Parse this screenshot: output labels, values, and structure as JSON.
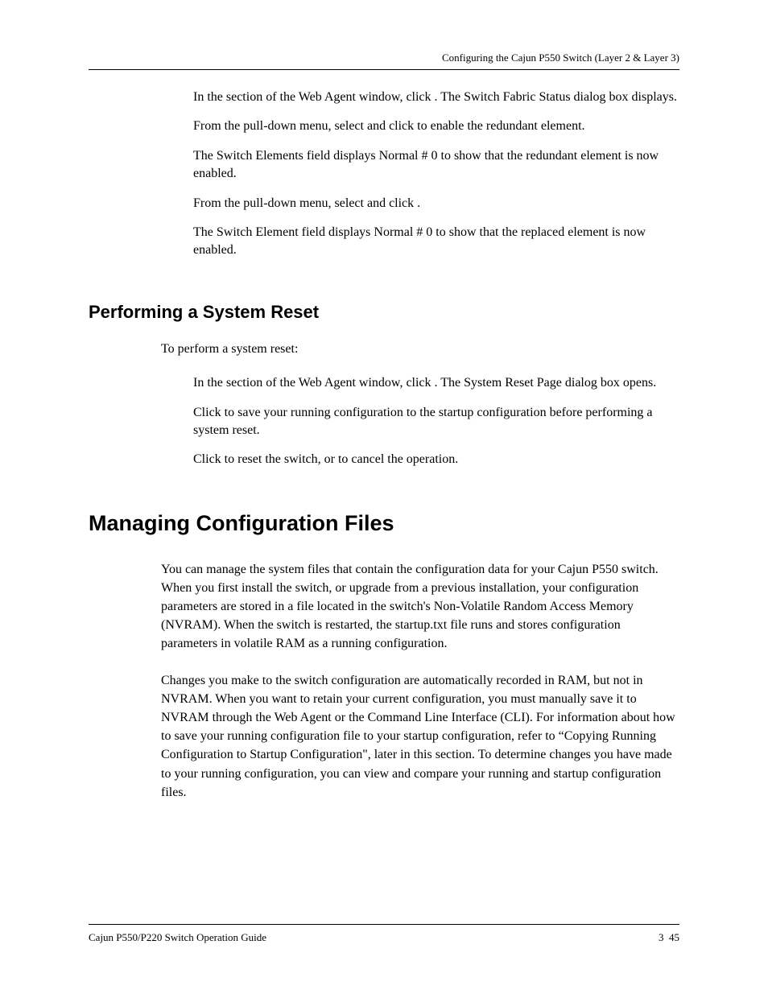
{
  "header": {
    "text": "Configuring the Cajun P550 Switch (Layer 2 & Layer 3)"
  },
  "section1": {
    "step1": "In the                                    section of the Web Agent window, click             . The Switch Fabric Status dialog box displays.",
    "step2a": "From the                                                        pull-down menu, select           and click               to enable the redundant element.",
    "step2b": "The Switch Elements field displays Normal # 0 to show that the redundant element is now enabled.",
    "step3a": "From the                                                        pull-down menu, select             and click             .",
    "step3b": "The Switch Element field displays Normal # 0 to show that the replaced element is now enabled."
  },
  "heading1": "Performing a System Reset",
  "reset": {
    "intro": "To perform a system reset:",
    "step1": "In the                                    section of the Web Agent window, click             . The System Reset Page dialog box opens.",
    "step2": "Click           to save your running configuration to the startup configuration before performing a system reset.",
    "step3": "Click           to reset the switch, or         to cancel the operation."
  },
  "heading2": "Managing Configuration Files",
  "manage": {
    "p1": "You can manage the system files that contain the configuration data for your Cajun P550 switch. When you first install the switch, or upgrade from a previous installation, your configuration parameters are stored in a                file located in the switch's Non-Volatile Random Access Memory (NVRAM). When the switch is restarted, the startup.txt file runs and stores configuration parameters in volatile RAM as a running configuration.",
    "p2": "Changes you make to the switch configuration are automatically recorded in RAM, but not in NVRAM. When you want to retain your current configuration, you must manually save it to NVRAM through the Web Agent or the Command Line Interface (CLI). For information about how to save your running configuration file to your startup configuration, refer to “Copying Running Configuration to Startup Configuration\", later in this section. To determine changes you have made to your running configuration, you can view and compare your running and startup configuration files."
  },
  "footer": {
    "left": "Cajun P550/P220 Switch Operation Guide",
    "right": "3 45"
  }
}
